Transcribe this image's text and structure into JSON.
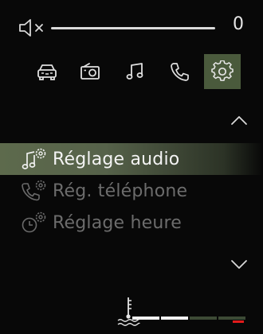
{
  "volume": {
    "value": "0",
    "level": 0.0,
    "muted": true
  },
  "tabs": [
    {
      "name": "vehicle",
      "icon": "car-icon",
      "active": false
    },
    {
      "name": "radio",
      "icon": "radio-icon",
      "active": false
    },
    {
      "name": "music",
      "icon": "music-note-icon",
      "active": false
    },
    {
      "name": "phone",
      "icon": "phone-icon",
      "active": false
    },
    {
      "name": "settings",
      "icon": "gear-icon",
      "active": true
    }
  ],
  "menu": {
    "items": [
      {
        "label": "Réglage audio",
        "icon": "audio-settings-icon",
        "selected": true
      },
      {
        "label": "Rég. téléphone",
        "icon": "phone-settings-icon",
        "selected": false
      },
      {
        "label": "Réglage heure",
        "icon": "clock-settings-icon",
        "selected": false
      }
    ]
  },
  "coolant_gauge": {
    "icon": "coolant-temperature-icon",
    "segments_lit": 2,
    "segments_total": 4,
    "colors": {
      "lit": "#f2f2f2",
      "unlit": "#3d4a35",
      "warning": "#e21b1b"
    }
  },
  "colors": {
    "accent": "#4a5a3c",
    "selected_row": "#5d6a4c",
    "dim_text": "#6c6c6c",
    "text": "#e8e8e8"
  }
}
